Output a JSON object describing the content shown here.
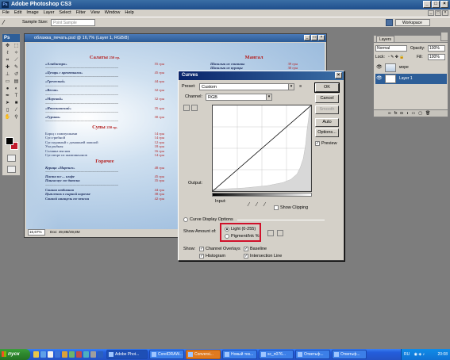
{
  "app": {
    "title": "Adobe Photoshop CS3",
    "icon_text": "Ps"
  },
  "menu": [
    "File",
    "Edit",
    "Image",
    "Layer",
    "Select",
    "Filter",
    "View",
    "Window",
    "Help"
  ],
  "options_bar": {
    "sample_size_label": "Sample Size:",
    "sample_size_value": "Point Sample",
    "workspace_label": "Workspace"
  },
  "toolbox": {
    "title": "Ps",
    "tools": [
      "move-icon",
      "marquee-icon",
      "lasso-icon",
      "magic-wand-icon",
      "crop-icon",
      "slice-icon",
      "healing-icon",
      "brush-icon",
      "stamp-icon",
      "history-brush-icon",
      "eraser-icon",
      "gradient-icon",
      "blur-icon",
      "dodge-icon",
      "pen-icon",
      "type-icon",
      "path-select-icon",
      "shape-icon",
      "notes-icon",
      "eyedropper-icon",
      "hand-icon",
      "zoom-icon"
    ],
    "fg_color": "#000000",
    "bg_color": "#c21b2c"
  },
  "document": {
    "title": "облажка_печать.psd @ 16,7% (Layer 1, RGB/8)",
    "zoom": "16,67%",
    "doc_info": "Doc: 49,8M/49,8M",
    "left_column": {
      "section1": "Салаты",
      "section1_weight": "250 гр.",
      "items1": [
        {
          "name": "«Алибистро»",
          "price": "55 грн"
        },
        {
          "name": "«Цезарь с креветками»",
          "price": "45 грн"
        },
        {
          "name": "«Греческий»",
          "price": "44 грн"
        },
        {
          "name": "«Весна»",
          "price": "32 грн"
        },
        {
          "name": "«Морской»",
          "price": "32 грн"
        },
        {
          "name": "«Итальянский»",
          "price": "35 грн"
        },
        {
          "name": "«Гурман»",
          "price": "30 грн"
        }
      ],
      "section2": "Супы",
      "section2_weight": "250 гр.",
      "items2": [
        {
          "name": "Борщ с пампушками",
          "price": "14 грн"
        },
        {
          "name": "Суп грибной",
          "price": "14 грн"
        },
        {
          "name": "Суп куриный с домашней лапшой",
          "price": "12 грн"
        },
        {
          "name": "Уха рыбная",
          "price": "18 грн"
        },
        {
          "name": "Солянка мясная",
          "price": "16 грн"
        },
        {
          "name": "Суп пюре из шампиньонов",
          "price": "14 грн"
        }
      ],
      "section3": "Горячее",
      "items3": [
        {
          "name": "Курица «Маренго»",
          "price": "48 грн"
        },
        {
          "name": "Паста по-... имфе",
          "price": "45 грн"
        },
        {
          "name": "Пангасиус по-датски",
          "price": "35 грн"
        },
        {
          "name": "Свиная отбивная",
          "price": "44 грн"
        },
        {
          "name": "Цыпленок в сырной корочке",
          "price": "38 грн"
        },
        {
          "name": "Свиной шницель по-венски",
          "price": "42 грн"
        }
      ]
    },
    "right_column": {
      "section1": "Мангал",
      "items1": [
        {
          "name": "Шашлык из свинины",
          "price": "39 грн"
        },
        {
          "name": "Шашлык из курицы",
          "price": "30 грн"
        }
      ]
    }
  },
  "curves": {
    "title": "Curves",
    "preset_label": "Preset:",
    "preset_value": "Custom",
    "channel_label": "Channel:",
    "channel_value": "RGB",
    "output_label": "Output:",
    "input_label": "Input:",
    "show_clipping": "Show Clipping",
    "curve_display_options": "Curve Display Options",
    "show_amount_label": "Show Amount of:",
    "light_option": "Light  (0-255)",
    "pigment_option": "Pigment/Ink %",
    "show_label": "Show:",
    "channel_overlays": "Channel Overlays",
    "baseline": "Baseline",
    "histogram": "Histogram",
    "intersection_line": "Intersection Line",
    "buttons": {
      "ok": "OK",
      "cancel": "Cancel",
      "smooth": "Smooth",
      "auto": "Auto",
      "options": "Options...",
      "preview": "Preview"
    }
  },
  "layers": {
    "tab": "Layers",
    "blend_mode": "Normal",
    "opacity_label": "Opacity:",
    "opacity_value": "100%",
    "lock_label": "Lock:",
    "fill_label": "Fill:",
    "fill_value": "100%",
    "layer_rows": [
      {
        "name": "море",
        "selected": false
      },
      {
        "name": "Layer 1",
        "selected": true
      }
    ]
  },
  "taskbar": {
    "start": "пуск",
    "tasks": [
      {
        "label": "Adobe Phot...",
        "active": true
      },
      {
        "label": "CorelDRAW...",
        "active": false
      },
      {
        "label": "Conversi...",
        "active": false,
        "highlight": true
      },
      {
        "label": "Новый тек...",
        "active": false
      },
      {
        "label": "sc_n076...",
        "active": false
      },
      {
        "label": "Ответьф...",
        "active": false
      },
      {
        "label": "Ответьф...",
        "active": false
      }
    ],
    "lang": "RU",
    "clock": "20:08"
  }
}
